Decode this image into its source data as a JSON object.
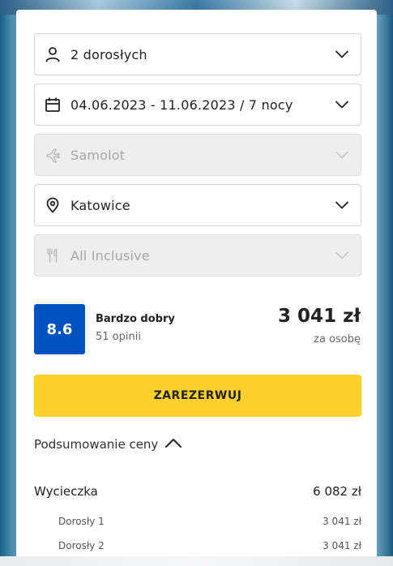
{
  "form": {
    "travelers": {
      "value": "2 dorosłych",
      "icon": "person-icon"
    },
    "dates": {
      "value": "04.06.2023 - 11.06.2023 / 7 nocy",
      "icon": "calendar-icon"
    },
    "transport": {
      "value": "Samolot",
      "icon": "plane-icon",
      "disabled": true
    },
    "departure": {
      "value": "Katowice",
      "icon": "location-pin-icon"
    },
    "board": {
      "value": "All Inclusive",
      "icon": "cutlery-icon",
      "disabled": true
    }
  },
  "rating": {
    "score": "8.6",
    "label": "Bardzo dobry",
    "reviews": "51 opinii",
    "color": "#0051c0"
  },
  "price": {
    "amount": "3 041 zł",
    "note": "za osobę"
  },
  "book_button": {
    "label": "ZAREZERWUJ",
    "color": "#fdd12a"
  },
  "summary": {
    "toggle_label": "Podsumowanie ceny",
    "items": [
      {
        "label": "Wycieczka",
        "value": "6 082 zł"
      },
      {
        "label": "Dorosły 1",
        "value": "3 041 zł"
      },
      {
        "label": "Dorosły 2",
        "value": "3 041 zł"
      }
    ]
  }
}
